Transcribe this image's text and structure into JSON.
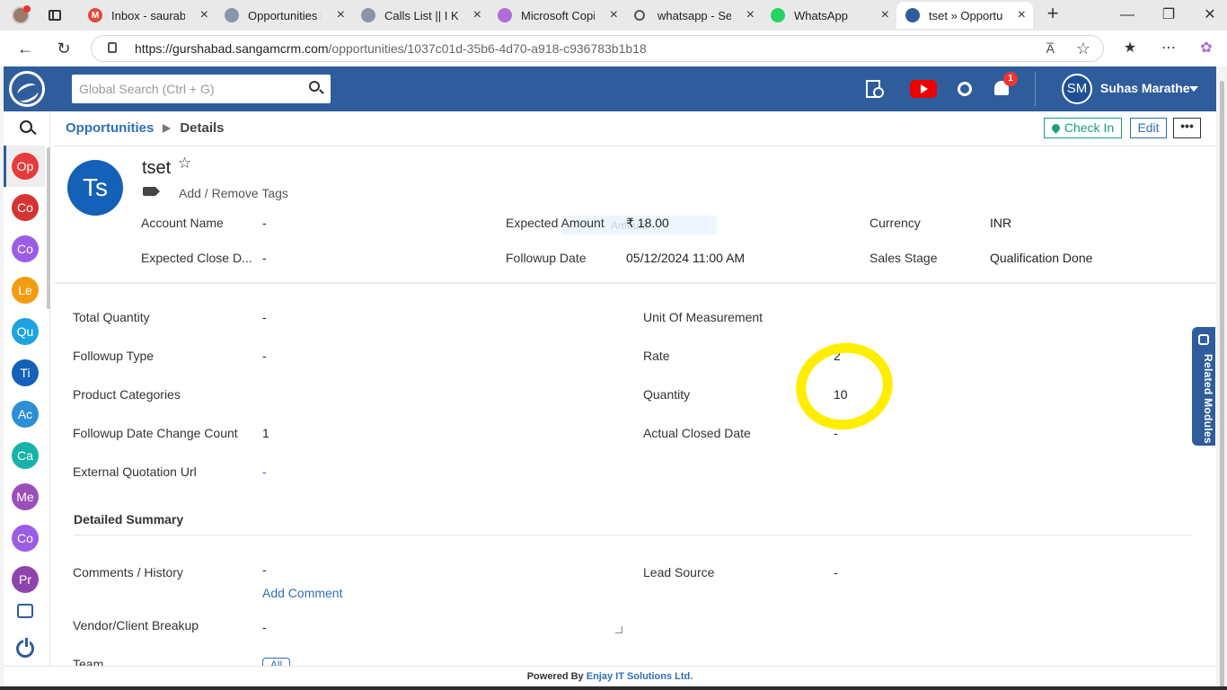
{
  "browser": {
    "tabs": [
      {
        "title": "Inbox - saurabhk",
        "fav": "M",
        "fav_color": "#e04a3b",
        "fav_icon": "gmail-icon"
      },
      {
        "title": "Opportunities Lis",
        "fav": "",
        "fav_color": "#8a95a8",
        "fav_icon": "crm-icon"
      },
      {
        "title": "Calls List || I Know",
        "fav": "",
        "fav_color": "#8a95a8",
        "fav_icon": "crm-icon"
      },
      {
        "title": "Microsoft Copilot",
        "fav": "",
        "fav_color": "#b06bd6",
        "fav_icon": "copilot-icon"
      },
      {
        "title": "whatsapp - Searc",
        "fav": "",
        "fav_color": "#e9e9e9",
        "fav_icon": "search-icon"
      },
      {
        "title": "WhatsApp",
        "fav": "",
        "fav_color": "#25d366",
        "fav_icon": "whatsapp-icon"
      },
      {
        "title": "tset » Opportuniti",
        "fav": "",
        "fav_color": "#2f5d9c",
        "fav_icon": "crm-icon",
        "active": true
      }
    ],
    "url_host": "https://gurshabad.sangamcrm.com",
    "url_path": "/opportunities/1037c01d-35b6-4d70-a918-c936783b1b18",
    "read_aloud": "A̅",
    "new_tab": "+"
  },
  "app": {
    "search_placeholder": "Global Search (Ctrl + G)",
    "notification_count": "1",
    "user_initials": "SM",
    "user_name": "Suhas Marathe",
    "brand_color": "#2f5d9c"
  },
  "sidebar": {
    "items": [
      {
        "label": "Op",
        "color": "#e63b3b"
      },
      {
        "label": "Co",
        "color": "#d63333"
      },
      {
        "label": "Co",
        "color": "#9b5de5"
      },
      {
        "label": "Le",
        "color": "#f39c12"
      },
      {
        "label": "Qu",
        "color": "#1fa3e0"
      },
      {
        "label": "Ti",
        "color": "#1361b8"
      },
      {
        "label": "Ac",
        "color": "#2d8fd5"
      },
      {
        "label": "Ca",
        "color": "#17b3a8"
      },
      {
        "label": "Me",
        "color": "#9b4fb8"
      },
      {
        "label": "Co",
        "color": "#9b5de5"
      },
      {
        "label": "Pr",
        "color": "#8e44ad"
      }
    ]
  },
  "breadcrumb": {
    "module": "Opportunities",
    "page": "Details"
  },
  "actions": {
    "check_in": "Check In",
    "edit": "Edit",
    "more": "•••"
  },
  "record": {
    "initials": "Ts",
    "title": "tset",
    "tags_label": "Add / Remove Tags",
    "header_fields": [
      {
        "label": "Account Name",
        "value": "-"
      },
      {
        "label": "Expected Amount",
        "value": "₹ 18.00"
      },
      {
        "label": "Currency",
        "value": "INR"
      },
      {
        "label": "Expected Close D...",
        "value": "-"
      },
      {
        "label": "Followup Date",
        "value": "05/12/2024 11:00 AM"
      },
      {
        "label": "Sales Stage",
        "value": "Qualification Done"
      }
    ],
    "amount_ghost": "Amount"
  },
  "details": {
    "left": [
      {
        "label": "Total Quantity",
        "value": "-"
      },
      {
        "label": "Followup Type",
        "value": "-"
      },
      {
        "label": "Product Categories",
        "value": ""
      },
      {
        "label": "Followup Date Change Count",
        "value": "1"
      },
      {
        "label": "External Quotation Url",
        "value": "-"
      }
    ],
    "right": [
      {
        "label": "Unit Of Measurement",
        "value": ""
      },
      {
        "label": "Rate",
        "value": "2"
      },
      {
        "label": "Quantity",
        "value": "10"
      },
      {
        "label": "Actual Closed Date",
        "value": "-"
      }
    ]
  },
  "summary": {
    "heading": "Detailed Summary",
    "comments_label": "Comments / History",
    "comments_value": "-",
    "add_comment": "Add Comment",
    "lead_source_label": "Lead Source",
    "lead_source_value": "-",
    "vendor_label": "Vendor/Client Breakup",
    "vendor_value": "-",
    "team_label": "Team",
    "team_button": "All"
  },
  "related_modules": "Related Modules",
  "footer": {
    "prefix": "Powered By",
    "company": "Enjay IT Solutions Ltd."
  }
}
